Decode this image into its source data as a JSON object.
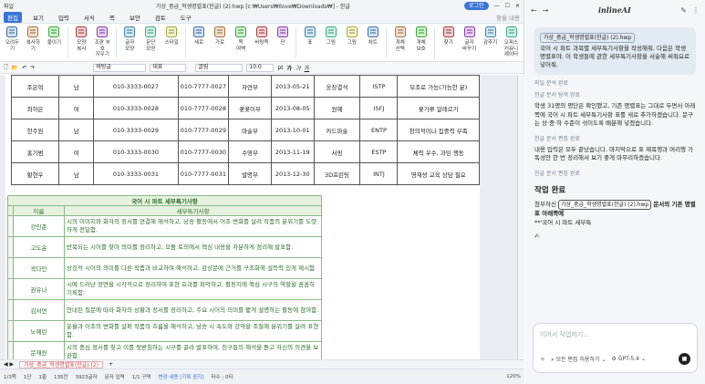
{
  "titlebar": {
    "app": "파일",
    "doc": "가상_중급_학생명렬표(한글) (2).hwp [c:₩Users₩ilove₩Downloads₩] - 한글",
    "search": "찾을 내용",
    "login": "로그인"
  },
  "menu": {
    "items": [
      "편집",
      "보기",
      "입력",
      "서식",
      "쪽",
      "보안",
      "검토",
      "도구"
    ],
    "active": 0,
    "right": "문서 보기"
  },
  "ribbon": [
    {
      "icon": "cut-icon",
      "label": "오려두기"
    },
    {
      "icon": "copy-icon",
      "label": "복사하기"
    },
    {
      "icon": "paste-icon",
      "label": "붙이기"
    },
    {
      "icon": "format-copy-icon",
      "label": "모양\n복사"
    },
    {
      "icon": "delete-icon",
      "label": "조판 부호\n지우기"
    },
    {
      "icon": "char-shape-icon",
      "label": "글자\n모양"
    },
    {
      "icon": "para-shape-icon",
      "label": "문단\n모양"
    },
    {
      "icon": "style-icon",
      "label": "스타일"
    },
    {
      "icon": "vertical-icon",
      "label": "세로"
    },
    {
      "icon": "horizontal-icon",
      "label": "가로"
    },
    {
      "icon": "page-icon",
      "label": "쪽\n여백"
    },
    {
      "icon": "background-icon",
      "label": "바탕쪽"
    },
    {
      "icon": "columns-icon",
      "label": "단"
    },
    {
      "icon": "table-icon",
      "label": "표"
    },
    {
      "icon": "shapes-icon",
      "label": "그림"
    },
    {
      "icon": "picture-icon",
      "label": "그림"
    },
    {
      "icon": "chart-icon",
      "label": "차트"
    },
    {
      "icon": "select-icon",
      "label": "개체\n선택"
    },
    {
      "icon": "save-icon",
      "label": "개체\n보호"
    },
    {
      "icon": "find-icon",
      "label": "찾기"
    },
    {
      "icon": "spell-icon",
      "label": "글자\n바꾸기"
    },
    {
      "icon": "hide-icon",
      "label": "감추기"
    },
    {
      "icon": "office-icon",
      "label": "오피스\n커뮤니케이터"
    }
  ],
  "formatbar": {
    "style": "바탕글",
    "font_lang": "대표",
    "font": "굴림",
    "size": "10.0",
    "unit": "pt"
  },
  "table1": [
    [
      "조은혁",
      "남",
      "010-3333-0027",
      "010-7777-0027",
      "자연부",
      "2013-05-21",
      "웅장결석",
      "ISTP",
      "모조로 가능(가능한 분)"
    ],
    [
      "최하은",
      "여",
      "010-3333-0028",
      "010-7777-0028",
      "꽃꽂이부",
      "2013-08-05",
      "원예",
      "ISFJ",
      "꽃가루 알레르기"
    ],
    [
      "한주원",
      "남",
      "010-3333-0029",
      "010-7777-0029",
      "마술부",
      "2013-10-01",
      "카드마술",
      "ENTP",
      "창의적이나 집중력 부족"
    ],
    [
      "홍기범",
      "여",
      "010-3333-0030",
      "010-7777-0030",
      "수영부",
      "2013-11-19",
      "서핑",
      "ESTP",
      "체력 우수, 과잉 행동"
    ],
    [
      "황현우",
      "남",
      "010-3333-0031",
      "010-7777-0031",
      "발명부",
      "2013-12-30",
      "3D프린팅",
      "INTJ",
      "영재성 교육 상담 필요"
    ]
  ],
  "table2": {
    "title": "국어 시 파트 세부특기사항",
    "headers": [
      "",
      "이름",
      "세부특기사항"
    ],
    "rows": [
      [
        "강민준",
        "시의 이미지와 화자의 정서를 연결해 해석하고, 낭송 활동에서 어조 변화를 살려 작품의 분위기를 도렷하게 전달함."
      ],
      [
        "고도윤",
        "반복되는 시어를 찾아 의미를 정리하고, 모둠 토의에서 핵심 내용을 차분하게 정리해 발표함."
      ],
      [
        "곽다인",
        "상징적 시어의 의미를 다른 작품과 비교하며 해석하고, 감상문에 근거를 구조화해 설득력 있게 제시함."
      ],
      [
        "권유나",
        "시에 드러난 장면을 시각적으로 정리하며 표현 효과를 파악하고, 활동지에 핵심 시구의 역할을 꼼꼼히 기록함."
      ],
      [
        "김서연",
        "안내된 질문에 따라 화자의 상황과 정서를 정리하고, 주요 시어의 의미를 짧게 설명하는 활동에 참여함."
      ],
      [
        "노예린",
        "운율과 어조의 변화를 살펴 작품의 흐름을 해석하고, 낭송 시 속도와 강약을 조절해 분위기를 살려 표현함."
      ],
      [
        "문재원",
        "시의 중심 정서를 찾고 이를 뒷받침하는 시구를 골라 발표하며, 친구들의 해석을 듣고 자신의 의견을 보완함."
      ]
    ]
  },
  "sheet": {
    "tab": "가상_중급_학생명렬표(한글) (2)"
  },
  "status": {
    "page": "1/3쪽",
    "section": "1단",
    "line": "1줄",
    "col": "135칸",
    "chars": "3923글자",
    "mode": "문자 입력",
    "section2": "1/1 구역",
    "change": "변경 내용 [기록 중지]",
    "typo": "타수 : 0타",
    "zoom": "120%"
  },
  "panel": {
    "logo": "inlineAI",
    "file_chip": "가상_중급_학생명렬표(한글) (2).hwp",
    "user_msg": "국어 시 파트 과목별 세부특기사항을 작성해줘. 다음은 학생 명렬표야. 이 학생들에 관한 세부특기사항을 서술해 써줘요로 넣어줘.",
    "meta1": "파일 분석 완료",
    "meta2": "한글 문서 탐색 완료",
    "p1": "학생 31명의 명단은 확인했고, 기존 명렬표는 그대로 두면서 아래쪽에 국어 시 파트 세부특기사항 표를 새로 추가하겠습니다. 문구는 상·중·하 수준이 섞이도록 배분해 넣겠습니다.",
    "meta3": "한글 문서 편집 완료",
    "p2": "내용 입력은 모두 끝났습니다. 마지막으로 표 제목행과 머리행 가독성만 한 번 정리해서 보기 좋게 마무리하겠습니다.",
    "meta4": "한글 문서 편집 완료",
    "done_title": "작업 완료",
    "done_pre": "첨부하신",
    "done_file": "가상_중급_학생명렬표(한글) (2).hwp",
    "done_mid": "문서의 기존 명렬표 아래쪽에",
    "done_last": "**'국어 시 파트 세부특",
    "input_ph": "이어서 작업하기...",
    "mode": "모든 편집 허용하기",
    "model": "GPT-5.4"
  }
}
